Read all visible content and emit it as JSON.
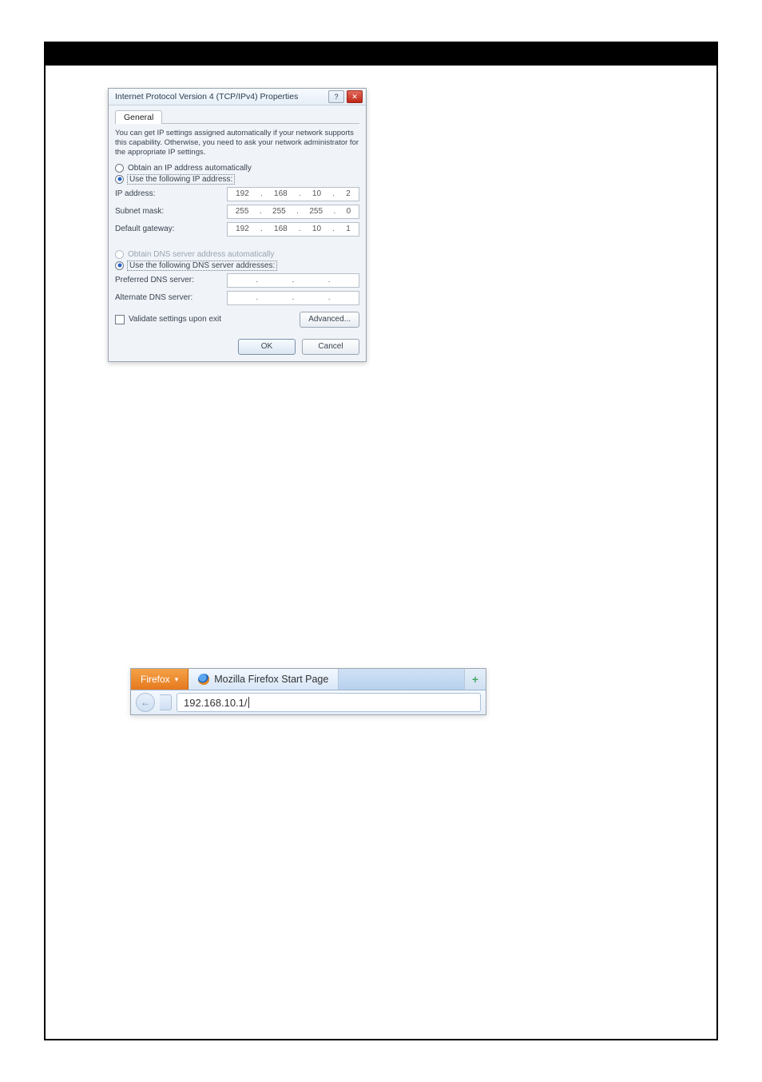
{
  "tcpip": {
    "title": "Internet Protocol Version 4 (TCP/IPv4) Properties",
    "tab_general": "General",
    "info": "You can get IP settings assigned automatically if your network supports this capability. Otherwise, you need to ask your network administrator for the appropriate IP settings.",
    "radio_auto_ip": "Obtain an IP address automatically",
    "radio_use_ip": "Use the following IP address:",
    "ip_address_label": "IP address:",
    "subnet_label": "Subnet mask:",
    "gateway_label": "Default gateway:",
    "radio_auto_dns": "Obtain DNS server address automatically",
    "radio_use_dns": "Use the following DNS server addresses:",
    "pref_dns_label": "Preferred DNS server:",
    "alt_dns_label": "Alternate DNS server:",
    "validate_label": "Validate settings upon exit",
    "advanced_btn": "Advanced...",
    "ok_btn": "OK",
    "cancel_btn": "Cancel",
    "ip_address": {
      "a": "192",
      "b": "168",
      "c": "10",
      "d": "2"
    },
    "subnet": {
      "a": "255",
      "b": "255",
      "c": "255",
      "d": "0"
    },
    "gateway": {
      "a": "192",
      "b": "168",
      "c": "10",
      "d": "1"
    }
  },
  "firefox": {
    "menu_label": "Firefox",
    "tab_title": "Mozilla Firefox Start Page",
    "new_tab_glyph": "+",
    "back_glyph": "←",
    "url_value": "192.168.10.1/"
  }
}
